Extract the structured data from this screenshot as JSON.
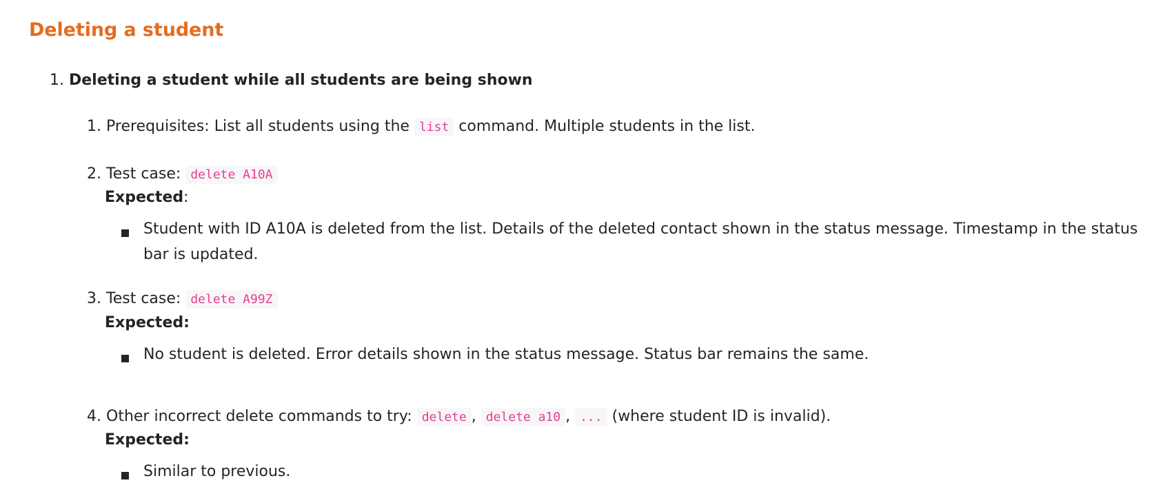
{
  "heading": "Deleting a student",
  "outer_item": {
    "number": "1.",
    "title": "Deleting a student while all students are being shown"
  },
  "steps": [
    {
      "number": "1.",
      "text_before": "Prerequisites: List all students using the",
      "code": "list",
      "text_after": "command. Multiple students in the list."
    },
    {
      "number": "2.",
      "label": "Test case:",
      "code": "delete A10A",
      "expected_label": "Expected",
      "expected_colon": ":",
      "bullet": "Student with ID A10A is deleted from the list. Details of the deleted contact shown in the status message. Timestamp in the status bar is updated."
    },
    {
      "number": "3.",
      "label": "Test case:",
      "code": "delete A99Z",
      "expected_label": "Expected:",
      "bullet": "No student is deleted. Error details shown in the status message. Status bar remains the same."
    },
    {
      "number": "4.",
      "label": "Other incorrect delete commands to try:",
      "codes": [
        "delete",
        "delete a10",
        "..."
      ],
      "separator": ",",
      "text_after": "(where student ID is invalid).",
      "expected_label": "Expected:",
      "bullet": "Similar to previous."
    }
  ]
}
